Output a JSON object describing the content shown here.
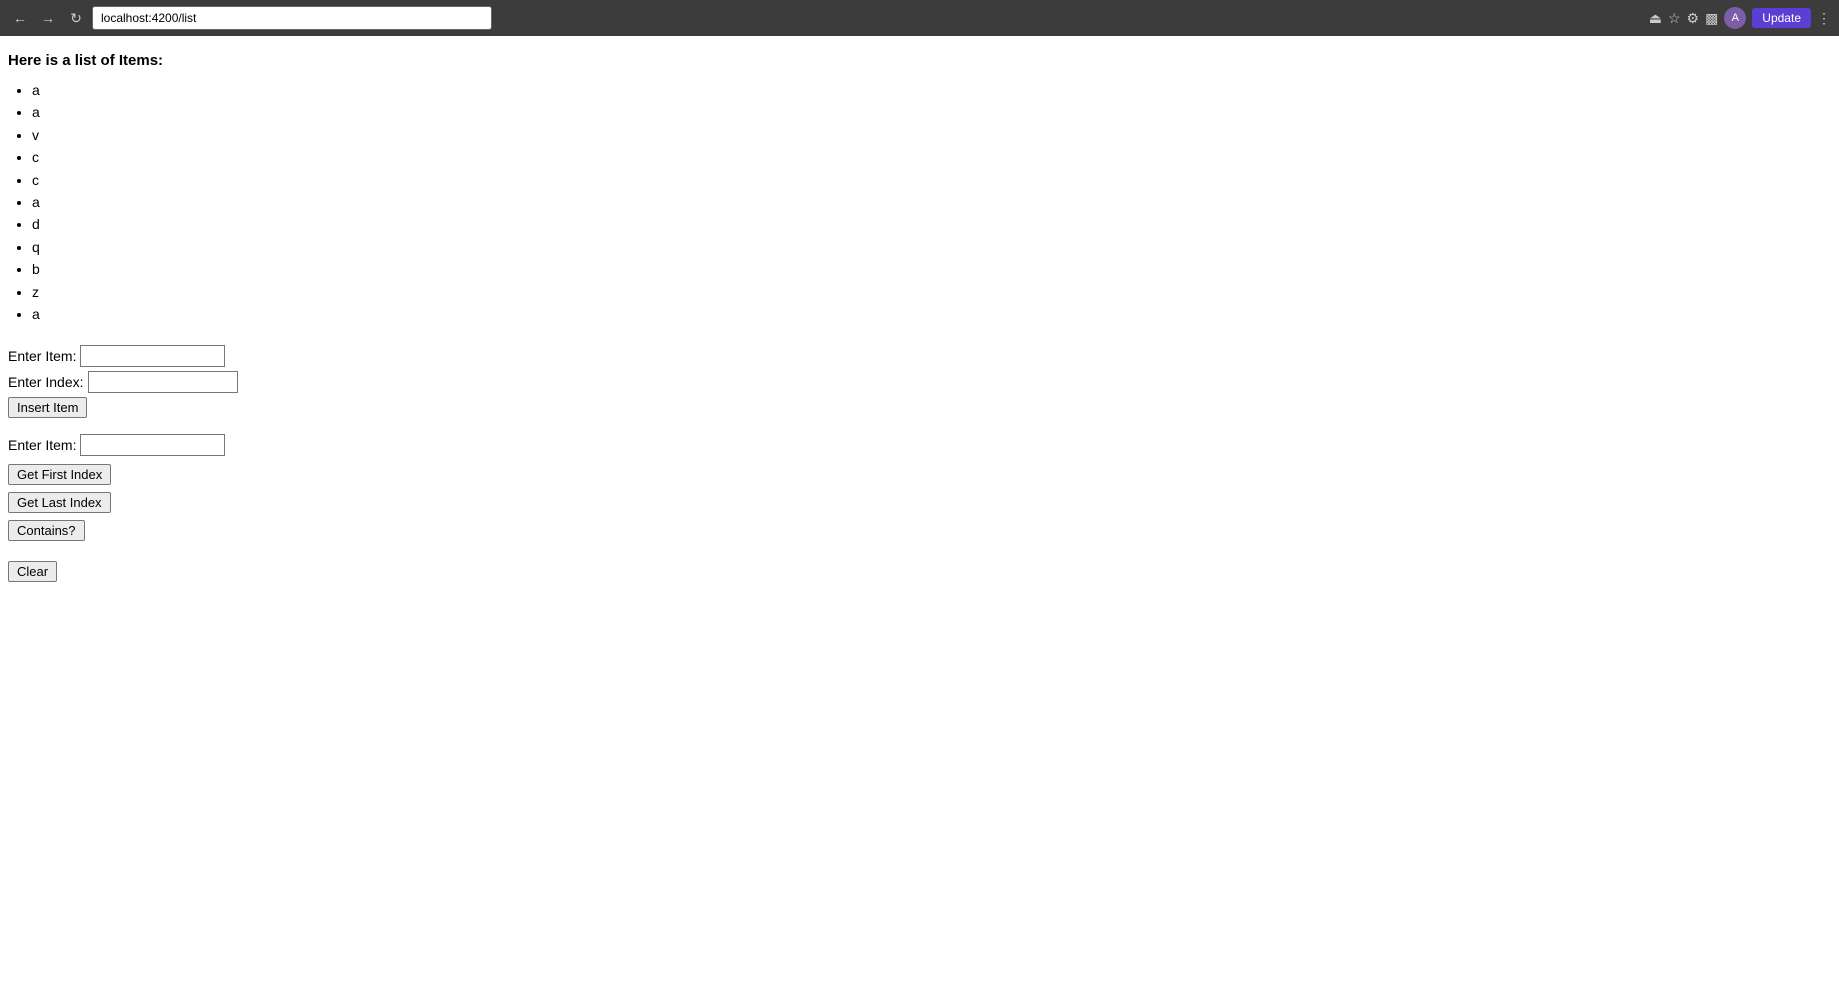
{
  "browser": {
    "url": "localhost:4200/list",
    "update_label": "Update",
    "avatar_label": "A"
  },
  "page": {
    "title": "Here is a list of Items:",
    "items": [
      "a",
      "a",
      "v",
      "c",
      "c",
      "a",
      "d",
      "q",
      "b",
      "z",
      "a"
    ]
  },
  "insert_section": {
    "item_label": "Enter Item:",
    "index_label": "Enter Index:",
    "item_placeholder": "",
    "index_placeholder": "",
    "insert_button_label": "Insert Item"
  },
  "search_section": {
    "item_label": "Enter Item:",
    "item_placeholder": "",
    "get_first_index_label": "Get First Index",
    "get_last_index_label": "Get Last Index",
    "contains_label": "Contains?"
  },
  "clear_section": {
    "clear_button_label": "Clear"
  }
}
